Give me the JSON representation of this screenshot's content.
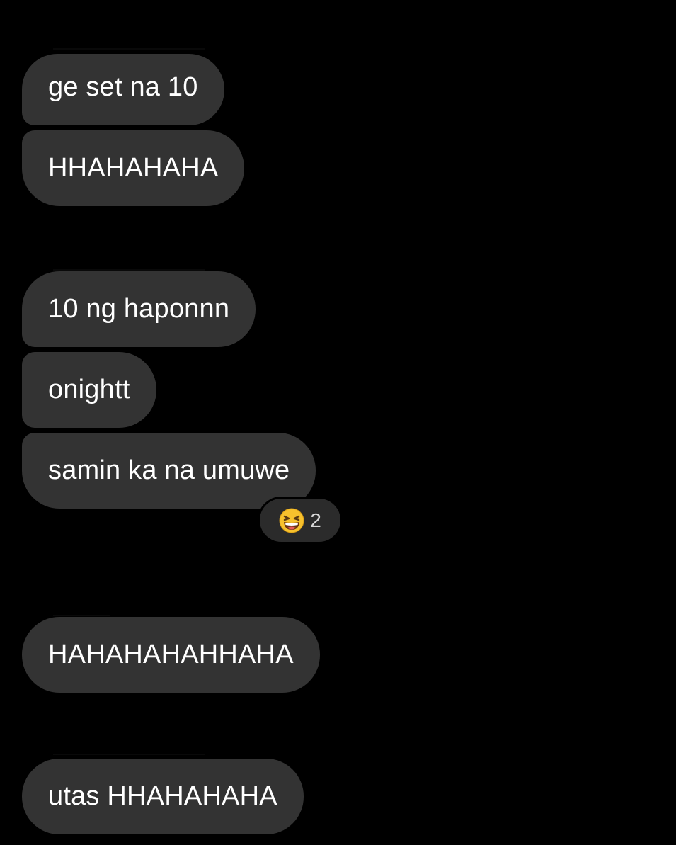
{
  "messages": [
    {
      "id": "m1",
      "text": "ge set na 10"
    },
    {
      "id": "m2",
      "text": "HHAHAHAHA"
    },
    {
      "id": "m3",
      "text": "10 ng haponnn"
    },
    {
      "id": "m4",
      "text": "onightt"
    },
    {
      "id": "m5",
      "text": "samin ka na umuwe"
    },
    {
      "id": "m6",
      "text": "HAHAHAHAHHAHA"
    },
    {
      "id": "m7",
      "text": "utas HHAHAHAHA"
    }
  ],
  "reaction": {
    "emoji": "laughing-squinting-face-icon",
    "count": "2"
  },
  "colors": {
    "background": "#000000",
    "bubble": "#333333",
    "reaction_bg": "#2b2b2b",
    "text": "#ffffff"
  }
}
